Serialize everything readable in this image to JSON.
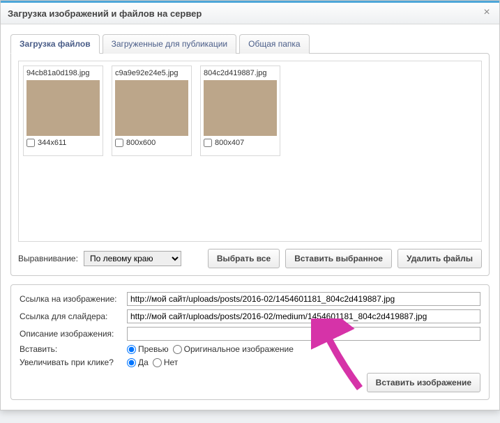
{
  "dialog": {
    "title": "Загрузка изображений и файлов на сервер",
    "close_glyph": "×"
  },
  "tabs": [
    {
      "label": "Загрузка файлов",
      "active": true
    },
    {
      "label": "Загруженные для публикации",
      "active": false
    },
    {
      "label": "Общая папка",
      "active": false
    }
  ],
  "thumbs": [
    {
      "filename": "94cb81a0d198.jpg",
      "dims": "344x611",
      "imgclass": "img1"
    },
    {
      "filename": "c9a9e92e24e5.jpg",
      "dims": "800x600",
      "imgclass": "img2"
    },
    {
      "filename": "804c2d419887.jpg",
      "dims": "800x407",
      "imgclass": "img3"
    }
  ],
  "align": {
    "label": "Выравнивание:",
    "selected": "По левому краю"
  },
  "buttons": {
    "select_all": "Выбрать все",
    "insert_selected": "Вставить выбранное",
    "delete_files": "Удалить файлы",
    "insert_image": "Вставить изображение"
  },
  "form": {
    "image_link_label": "Ссылка на изображение:",
    "image_link_value": "http://мой сайт/uploads/posts/2016-02/1454601181_804c2d419887.jpg",
    "slider_link_label": "Ссылка для слайдера:",
    "slider_link_value": "http://мой сайт/uploads/posts/2016-02/medium/1454601181_804c2d419887.jpg",
    "description_label": "Описание изображения:",
    "description_value": "",
    "insert_label": "Вставить:",
    "insert_opt_preview": "Превью",
    "insert_opt_original": "Оригинальное изображение",
    "zoom_label": "Увеличивать при клике?",
    "zoom_yes": "Да",
    "zoom_no": "Нет"
  }
}
